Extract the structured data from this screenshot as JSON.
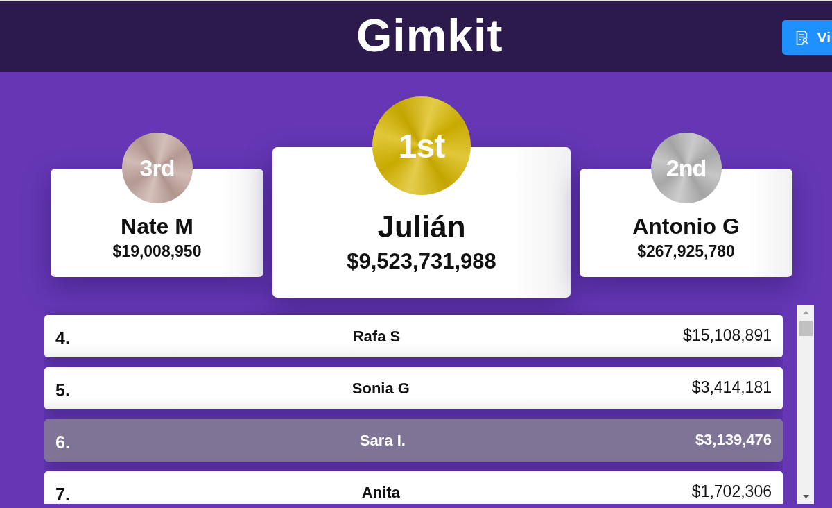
{
  "header": {
    "logo": "Gimkit",
    "button": {
      "label": "Vi"
    }
  },
  "podium": [
    {
      "kind": "placer",
      "place": "3rd",
      "color": "#c4a69f",
      "name": "Nate M",
      "amount": "$19,008,950"
    },
    {
      "kind": "winner",
      "place": "1st",
      "color": "#d9b800",
      "name": "Julián",
      "amount": "$9,523,731,988"
    },
    {
      "kind": "placer",
      "place": "2nd",
      "color": "#b6b6b6",
      "name": "Antonio G",
      "amount": "$267,925,780"
    }
  ],
  "leaderboard": {
    "rows": [
      {
        "rank": "4.",
        "name": "Rafa S",
        "amount": "$15,108,891",
        "selected": false
      },
      {
        "rank": "5.",
        "name": "Sonia G",
        "amount": "$3,414,181",
        "selected": false
      },
      {
        "rank": "6.",
        "name": "Sara I.",
        "amount": "$3,139,476",
        "selected": true
      },
      {
        "rank": "7.",
        "name": "Anita",
        "amount": "$1,702,306",
        "selected": false
      }
    ]
  }
}
